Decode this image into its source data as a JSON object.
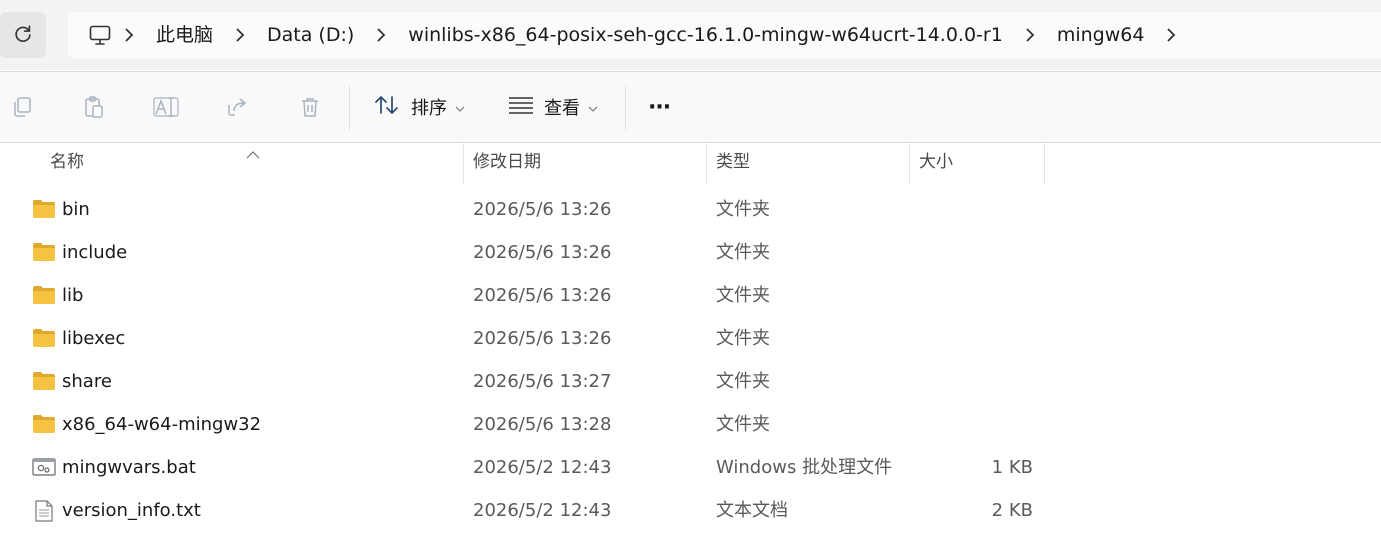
{
  "address": {
    "refresh_icon": "refresh-icon",
    "root_icon": "monitor-icon",
    "crumbs": [
      "此电脑",
      "Data (D:)",
      "winlibs-x86_64-posix-seh-gcc-16.1.0-mingw-w64ucrt-14.0.0-r1",
      "mingw64"
    ]
  },
  "toolbar": {
    "sort_label": "排序",
    "view_label": "查看",
    "more_label": "···"
  },
  "columns": {
    "name": "名称",
    "date": "修改日期",
    "type": "类型",
    "size": "大小"
  },
  "files": [
    {
      "name": "bin",
      "date": "2026/5/6 13:26",
      "type": "文件夹",
      "size": "",
      "kind": "folder"
    },
    {
      "name": "include",
      "date": "2026/5/6 13:26",
      "type": "文件夹",
      "size": "",
      "kind": "folder"
    },
    {
      "name": "lib",
      "date": "2026/5/6 13:26",
      "type": "文件夹",
      "size": "",
      "kind": "folder"
    },
    {
      "name": "libexec",
      "date": "2026/5/6 13:26",
      "type": "文件夹",
      "size": "",
      "kind": "folder"
    },
    {
      "name": "share",
      "date": "2026/5/6 13:27",
      "type": "文件夹",
      "size": "",
      "kind": "folder"
    },
    {
      "name": "x86_64-w64-mingw32",
      "date": "2026/5/6 13:28",
      "type": "文件夹",
      "size": "",
      "kind": "folder"
    },
    {
      "name": "mingwvars.bat",
      "date": "2026/5/2 12:43",
      "type": "Windows 批处理文件",
      "size": "1 KB",
      "kind": "batch"
    },
    {
      "name": "version_info.txt",
      "date": "2026/5/2 12:43",
      "type": "文本文档",
      "size": "2 KB",
      "kind": "text"
    }
  ],
  "colors": {
    "folder": "#f5c342",
    "folder_dark": "#e0a82e",
    "icon_gray": "#9aa0a6"
  }
}
